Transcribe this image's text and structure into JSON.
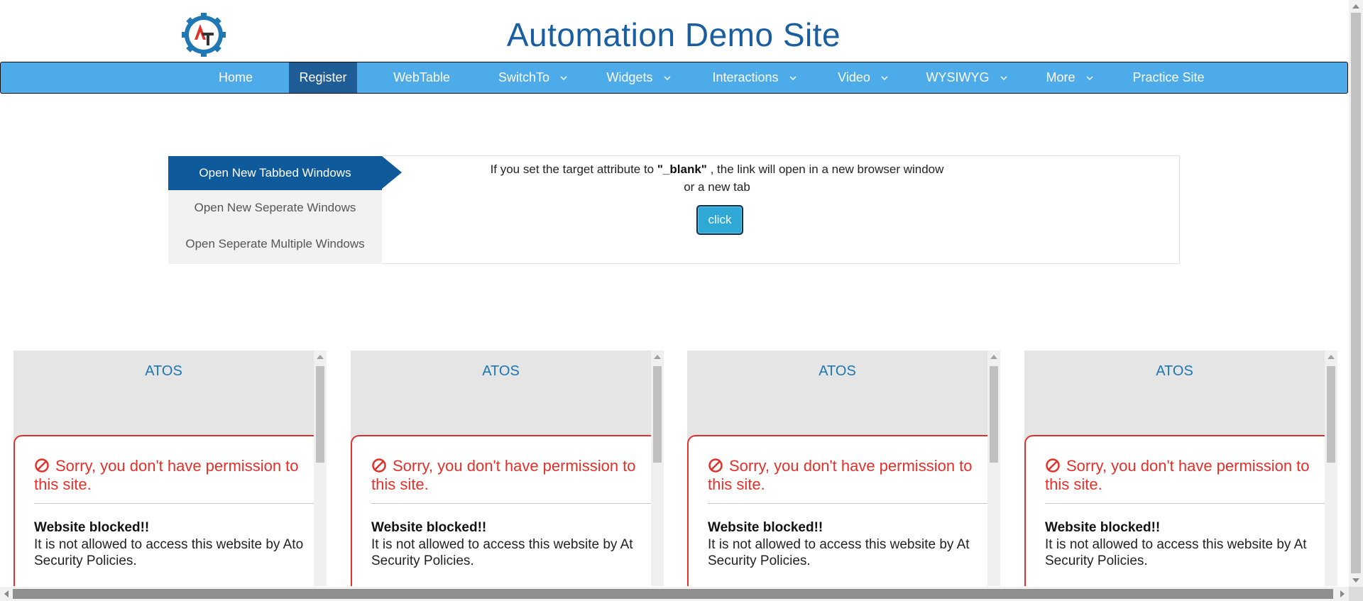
{
  "header": {
    "title": "Automation Demo Site",
    "logo_text": "AT"
  },
  "nav": {
    "items": [
      {
        "label": "Home",
        "dropdown": false
      },
      {
        "label": "Register",
        "dropdown": false,
        "active": true
      },
      {
        "label": "WebTable",
        "dropdown": false
      },
      {
        "label": "SwitchTo",
        "dropdown": true
      },
      {
        "label": "Widgets",
        "dropdown": true
      },
      {
        "label": "Interactions",
        "dropdown": true
      },
      {
        "label": "Video",
        "dropdown": true
      },
      {
        "label": "WYSIWYG",
        "dropdown": true
      },
      {
        "label": "More",
        "dropdown": true
      },
      {
        "label": "Practice Site",
        "dropdown": false
      }
    ]
  },
  "tabs": {
    "items": [
      {
        "label": "Open New Tabbed Windows",
        "active": true
      },
      {
        "label": "Open New Seperate Windows"
      },
      {
        "label": "Open Seperate Multiple Windows"
      }
    ]
  },
  "content": {
    "desc_before": "If you set the target attribute to ",
    "desc_bold": "\"_blank\"",
    "desc_after": " , the link will open in a new browser window",
    "desc_line2": "or a new tab",
    "button_label": "click"
  },
  "frames": {
    "items": [
      {
        "title": "ATOS",
        "sorry": "Sorry, you don't have permission to",
        "sorry2": "this site.",
        "heading": "Website blocked!!",
        "line1": "It is not allowed to access this website by Ato",
        "line2": "Security Policies."
      },
      {
        "title": "ATOS",
        "sorry": "Sorry, you don't have permission to",
        "sorry2": "this site.",
        "heading": "Website blocked!!",
        "line1": "It is not allowed to access this website by At",
        "line2": "Security Policies."
      },
      {
        "title": "ATOS",
        "sorry": "Sorry, you don't have permission to",
        "sorry2": "this site.",
        "heading": "Website blocked!!",
        "line1": "It is not allowed to access this website by At",
        "line2": "Security Policies."
      },
      {
        "title": "ATOS",
        "sorry": "Sorry, you don't have permission to",
        "sorry2": "this site.",
        "heading": "Website blocked!!",
        "line1": "It is not allowed to access this website by At",
        "line2": "Security Policies."
      }
    ]
  },
  "colors": {
    "brand": "#1a5ea2",
    "nav_bg": "#4dabea",
    "nav_active": "#1e5d96",
    "tab_active": "#0f5a9a",
    "error": "#e5302a",
    "button": "#2fa8d6"
  }
}
